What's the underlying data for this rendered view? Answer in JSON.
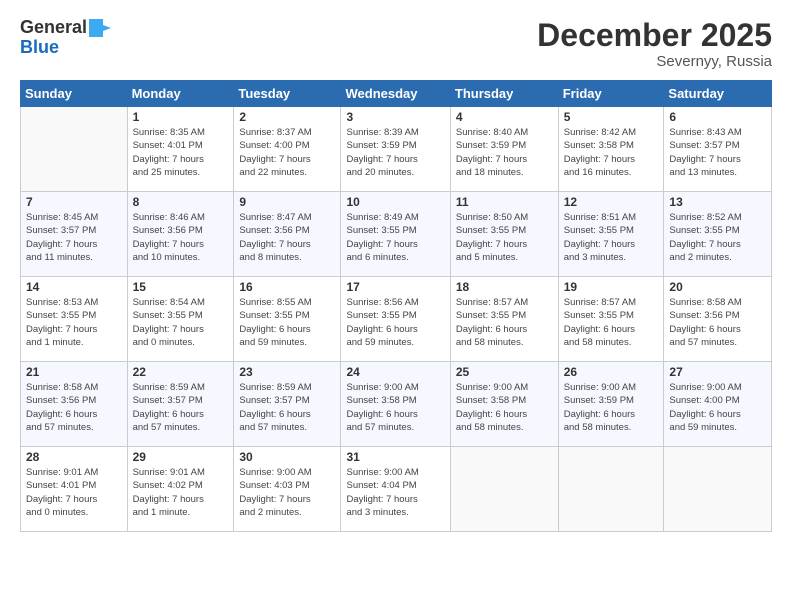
{
  "header": {
    "logo_line1": "General",
    "logo_line2": "Blue",
    "month_title": "December 2025",
    "location": "Severnyy, Russia"
  },
  "days_of_week": [
    "Sunday",
    "Monday",
    "Tuesday",
    "Wednesday",
    "Thursday",
    "Friday",
    "Saturday"
  ],
  "weeks": [
    [
      {
        "day": "",
        "info": ""
      },
      {
        "day": "1",
        "info": "Sunrise: 8:35 AM\nSunset: 4:01 PM\nDaylight: 7 hours\nand 25 minutes."
      },
      {
        "day": "2",
        "info": "Sunrise: 8:37 AM\nSunset: 4:00 PM\nDaylight: 7 hours\nand 22 minutes."
      },
      {
        "day": "3",
        "info": "Sunrise: 8:39 AM\nSunset: 3:59 PM\nDaylight: 7 hours\nand 20 minutes."
      },
      {
        "day": "4",
        "info": "Sunrise: 8:40 AM\nSunset: 3:59 PM\nDaylight: 7 hours\nand 18 minutes."
      },
      {
        "day": "5",
        "info": "Sunrise: 8:42 AM\nSunset: 3:58 PM\nDaylight: 7 hours\nand 16 minutes."
      },
      {
        "day": "6",
        "info": "Sunrise: 8:43 AM\nSunset: 3:57 PM\nDaylight: 7 hours\nand 13 minutes."
      }
    ],
    [
      {
        "day": "7",
        "info": "Sunrise: 8:45 AM\nSunset: 3:57 PM\nDaylight: 7 hours\nand 11 minutes."
      },
      {
        "day": "8",
        "info": "Sunrise: 8:46 AM\nSunset: 3:56 PM\nDaylight: 7 hours\nand 10 minutes."
      },
      {
        "day": "9",
        "info": "Sunrise: 8:47 AM\nSunset: 3:56 PM\nDaylight: 7 hours\nand 8 minutes."
      },
      {
        "day": "10",
        "info": "Sunrise: 8:49 AM\nSunset: 3:55 PM\nDaylight: 7 hours\nand 6 minutes."
      },
      {
        "day": "11",
        "info": "Sunrise: 8:50 AM\nSunset: 3:55 PM\nDaylight: 7 hours\nand 5 minutes."
      },
      {
        "day": "12",
        "info": "Sunrise: 8:51 AM\nSunset: 3:55 PM\nDaylight: 7 hours\nand 3 minutes."
      },
      {
        "day": "13",
        "info": "Sunrise: 8:52 AM\nSunset: 3:55 PM\nDaylight: 7 hours\nand 2 minutes."
      }
    ],
    [
      {
        "day": "14",
        "info": "Sunrise: 8:53 AM\nSunset: 3:55 PM\nDaylight: 7 hours\nand 1 minute."
      },
      {
        "day": "15",
        "info": "Sunrise: 8:54 AM\nSunset: 3:55 PM\nDaylight: 7 hours\nand 0 minutes."
      },
      {
        "day": "16",
        "info": "Sunrise: 8:55 AM\nSunset: 3:55 PM\nDaylight: 6 hours\nand 59 minutes."
      },
      {
        "day": "17",
        "info": "Sunrise: 8:56 AM\nSunset: 3:55 PM\nDaylight: 6 hours\nand 59 minutes."
      },
      {
        "day": "18",
        "info": "Sunrise: 8:57 AM\nSunset: 3:55 PM\nDaylight: 6 hours\nand 58 minutes."
      },
      {
        "day": "19",
        "info": "Sunrise: 8:57 AM\nSunset: 3:55 PM\nDaylight: 6 hours\nand 58 minutes."
      },
      {
        "day": "20",
        "info": "Sunrise: 8:58 AM\nSunset: 3:56 PM\nDaylight: 6 hours\nand 57 minutes."
      }
    ],
    [
      {
        "day": "21",
        "info": "Sunrise: 8:58 AM\nSunset: 3:56 PM\nDaylight: 6 hours\nand 57 minutes."
      },
      {
        "day": "22",
        "info": "Sunrise: 8:59 AM\nSunset: 3:57 PM\nDaylight: 6 hours\nand 57 minutes."
      },
      {
        "day": "23",
        "info": "Sunrise: 8:59 AM\nSunset: 3:57 PM\nDaylight: 6 hours\nand 57 minutes."
      },
      {
        "day": "24",
        "info": "Sunrise: 9:00 AM\nSunset: 3:58 PM\nDaylight: 6 hours\nand 57 minutes."
      },
      {
        "day": "25",
        "info": "Sunrise: 9:00 AM\nSunset: 3:58 PM\nDaylight: 6 hours\nand 58 minutes."
      },
      {
        "day": "26",
        "info": "Sunrise: 9:00 AM\nSunset: 3:59 PM\nDaylight: 6 hours\nand 58 minutes."
      },
      {
        "day": "27",
        "info": "Sunrise: 9:00 AM\nSunset: 4:00 PM\nDaylight: 6 hours\nand 59 minutes."
      }
    ],
    [
      {
        "day": "28",
        "info": "Sunrise: 9:01 AM\nSunset: 4:01 PM\nDaylight: 7 hours\nand 0 minutes."
      },
      {
        "day": "29",
        "info": "Sunrise: 9:01 AM\nSunset: 4:02 PM\nDaylight: 7 hours\nand 1 minute."
      },
      {
        "day": "30",
        "info": "Sunrise: 9:00 AM\nSunset: 4:03 PM\nDaylight: 7 hours\nand 2 minutes."
      },
      {
        "day": "31",
        "info": "Sunrise: 9:00 AM\nSunset: 4:04 PM\nDaylight: 7 hours\nand 3 minutes."
      },
      {
        "day": "",
        "info": ""
      },
      {
        "day": "",
        "info": ""
      },
      {
        "day": "",
        "info": ""
      }
    ]
  ]
}
